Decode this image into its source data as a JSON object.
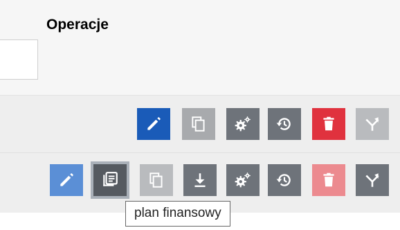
{
  "header": {
    "column_title": "Operacje"
  },
  "tooltip": {
    "text": "plan finansowy"
  },
  "row1": {
    "buttons": [
      {
        "icon": "edit-icon"
      },
      {
        "icon": "copy-icon"
      },
      {
        "icon": "settings-gears-icon"
      },
      {
        "icon": "history-icon"
      },
      {
        "icon": "delete-icon"
      },
      {
        "icon": "merge-icon"
      }
    ]
  },
  "row2": {
    "buttons": [
      {
        "icon": "edit-icon"
      },
      {
        "icon": "financial-plan-icon"
      },
      {
        "icon": "copy-icon"
      },
      {
        "icon": "download-icon"
      },
      {
        "icon": "settings-gears-icon"
      },
      {
        "icon": "history-icon"
      },
      {
        "icon": "delete-icon"
      },
      {
        "icon": "merge-icon"
      }
    ]
  },
  "colors": {
    "edit": "#1a5bb8",
    "edit_light": "#5b8fd6",
    "neutral": "#a8aaad",
    "dark": "#6e737a",
    "delete": "#e0323e",
    "delete_light": "#ec8a8f"
  }
}
